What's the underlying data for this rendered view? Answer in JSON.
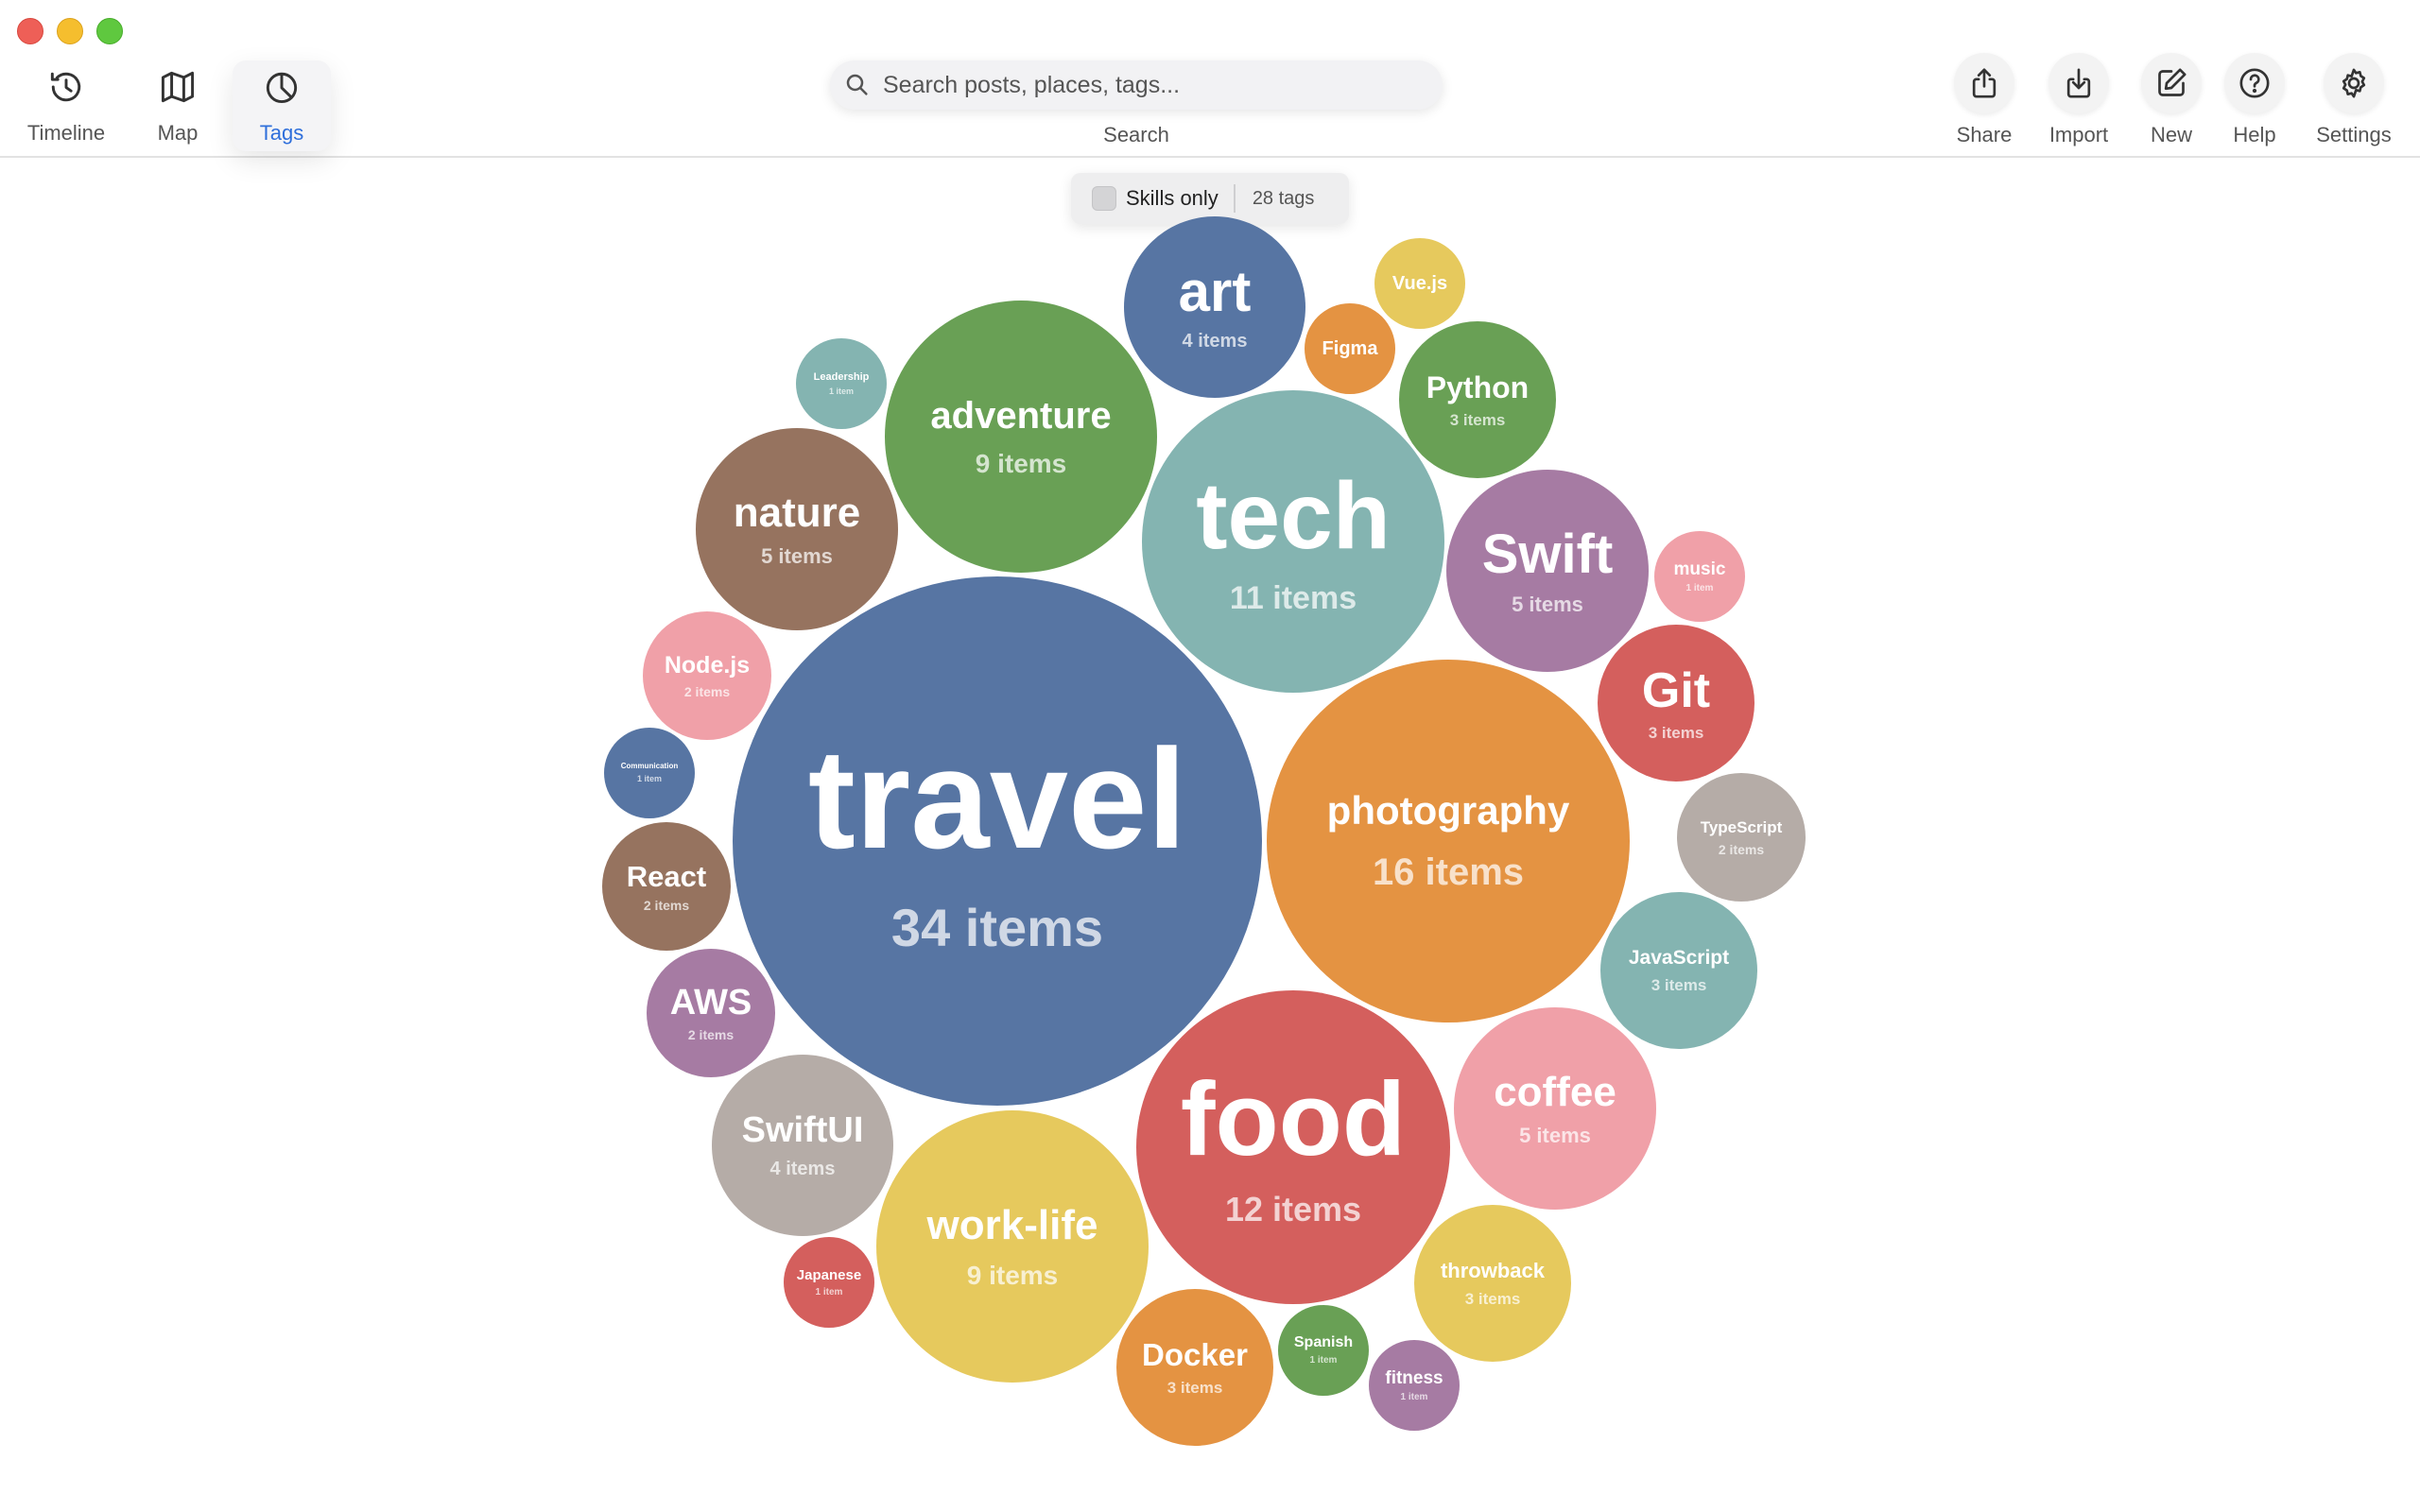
{
  "toolbar": {
    "nav": [
      {
        "label": "Timeline",
        "icon": "clock-icon"
      },
      {
        "label": "Map",
        "icon": "map-icon"
      },
      {
        "label": "Tags",
        "icon": "pie-chart-icon",
        "active": true
      }
    ],
    "search": {
      "placeholder": "Search posts, places, tags...",
      "label": "Search"
    },
    "actions": [
      {
        "label": "Share",
        "icon": "share-icon"
      },
      {
        "label": "Import",
        "icon": "import-icon"
      },
      {
        "label": "New",
        "icon": "compose-icon"
      },
      {
        "label": "Help",
        "icon": "help-icon"
      },
      {
        "label": "Settings",
        "icon": "gear-icon"
      }
    ]
  },
  "filter": {
    "label": "Skills only",
    "checked": false,
    "count": "28 tags"
  },
  "colors": {
    "blue": "#5775a3",
    "teal": "#84b4b1",
    "green": "#69a055",
    "brown": "#96735f",
    "orange": "#e49342",
    "red": "#d45f5d",
    "pink": "#f0a0a8",
    "yellow": "#e6c95d",
    "purple": "#a67ba3",
    "gray": "#b5aca7",
    "accent": "#2f6fdb"
  },
  "tags": [
    {
      "name": "travel",
      "count": "34 items",
      "color": "blue"
    },
    {
      "name": "photography",
      "count": "16 items",
      "color": "orange"
    },
    {
      "name": "food",
      "count": "12 items",
      "color": "red"
    },
    {
      "name": "tech",
      "count": "11 items",
      "color": "teal"
    },
    {
      "name": "adventure",
      "count": "9 items",
      "color": "green"
    },
    {
      "name": "work-life",
      "count": "9 items",
      "color": "yellow"
    },
    {
      "name": "nature",
      "count": "5 items",
      "color": "brown"
    },
    {
      "name": "Swift",
      "count": "5 items",
      "color": "purple"
    },
    {
      "name": "coffee",
      "count": "5 items",
      "color": "pink"
    },
    {
      "name": "art",
      "count": "4 items",
      "color": "blue"
    },
    {
      "name": "SwiftUI",
      "count": "4 items",
      "color": "gray"
    },
    {
      "name": "Python",
      "count": "3 items",
      "color": "green"
    },
    {
      "name": "Git",
      "count": "3 items",
      "color": "red"
    },
    {
      "name": "JavaScript",
      "count": "3 items",
      "color": "teal"
    },
    {
      "name": "throwback",
      "count": "3 items",
      "color": "yellow"
    },
    {
      "name": "Docker",
      "count": "3 items",
      "color": "orange"
    },
    {
      "name": "Node.js",
      "count": "2 items",
      "color": "pink"
    },
    {
      "name": "React",
      "count": "2 items",
      "color": "brown"
    },
    {
      "name": "AWS",
      "count": "2 items",
      "color": "purple"
    },
    {
      "name": "TypeScript",
      "count": "2 items",
      "color": "gray"
    },
    {
      "name": "Vue.js",
      "count": "",
      "color": "yellow"
    },
    {
      "name": "Figma",
      "count": "",
      "color": "orange"
    },
    {
      "name": "Leadership",
      "count": "1 item",
      "color": "teal"
    },
    {
      "name": "music",
      "count": "1 item",
      "color": "pink"
    },
    {
      "name": "Communication",
      "count": "1 item",
      "color": "blue"
    },
    {
      "name": "Japanese",
      "count": "1 item",
      "color": "red"
    },
    {
      "name": "Spanish",
      "count": "1 item",
      "color": "green"
    },
    {
      "name": "fitness",
      "count": "1 item",
      "color": "purple"
    }
  ]
}
